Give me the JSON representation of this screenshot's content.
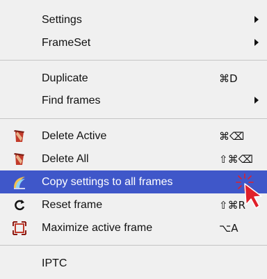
{
  "menu": {
    "items": [
      {
        "label": "Settings",
        "submenu": true
      },
      {
        "label": "FrameSet",
        "submenu": true
      },
      {
        "label": "Duplicate",
        "shortcut": "⌘D"
      },
      {
        "label": "Find frames",
        "submenu": true
      },
      {
        "label": "Delete Active",
        "shortcut": "⌘⌫",
        "icon": "trash-icon"
      },
      {
        "label": "Delete All",
        "shortcut": "⇧⌘⌫",
        "icon": "trash-icon"
      },
      {
        "label": "Copy settings to all frames",
        "icon": "copy-settings-icon",
        "highlighted": true
      },
      {
        "label": "Reset frame",
        "shortcut": "⇧⌘R",
        "icon": "reset-icon"
      },
      {
        "label": "Maximize active frame",
        "shortcut": "⌥A",
        "icon": "maximize-icon"
      },
      {
        "label": "IPTC"
      }
    ]
  },
  "colors": {
    "highlight": "#3f57c9",
    "menu_background": "#f0f0f0",
    "cursor": "#e0202a"
  }
}
